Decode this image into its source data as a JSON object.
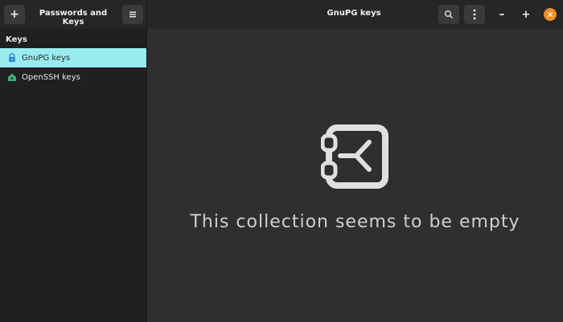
{
  "header": {
    "app_title": "Passwords and Keys",
    "window_title": "GnuPG keys",
    "add_label": "+",
    "menu_icon": "hamburger-menu-icon",
    "search_icon": "search-icon",
    "kebab_icon": "kebab-menu-icon",
    "minimize_label": "–",
    "maximize_label": "+",
    "close_label": "✕",
    "close_color": "#f48d27"
  },
  "sidebar": {
    "heading": "Keys",
    "items": [
      {
        "label": "GnuPG keys",
        "icon": "gnupg-key-icon",
        "selected": true
      },
      {
        "label": "OpenSSH keys",
        "icon": "ssh-key-icon",
        "selected": false
      }
    ],
    "selected_color": "#98ecef"
  },
  "main": {
    "empty_message": "This collection seems to be empty",
    "empty_icon": "vault-icon"
  }
}
